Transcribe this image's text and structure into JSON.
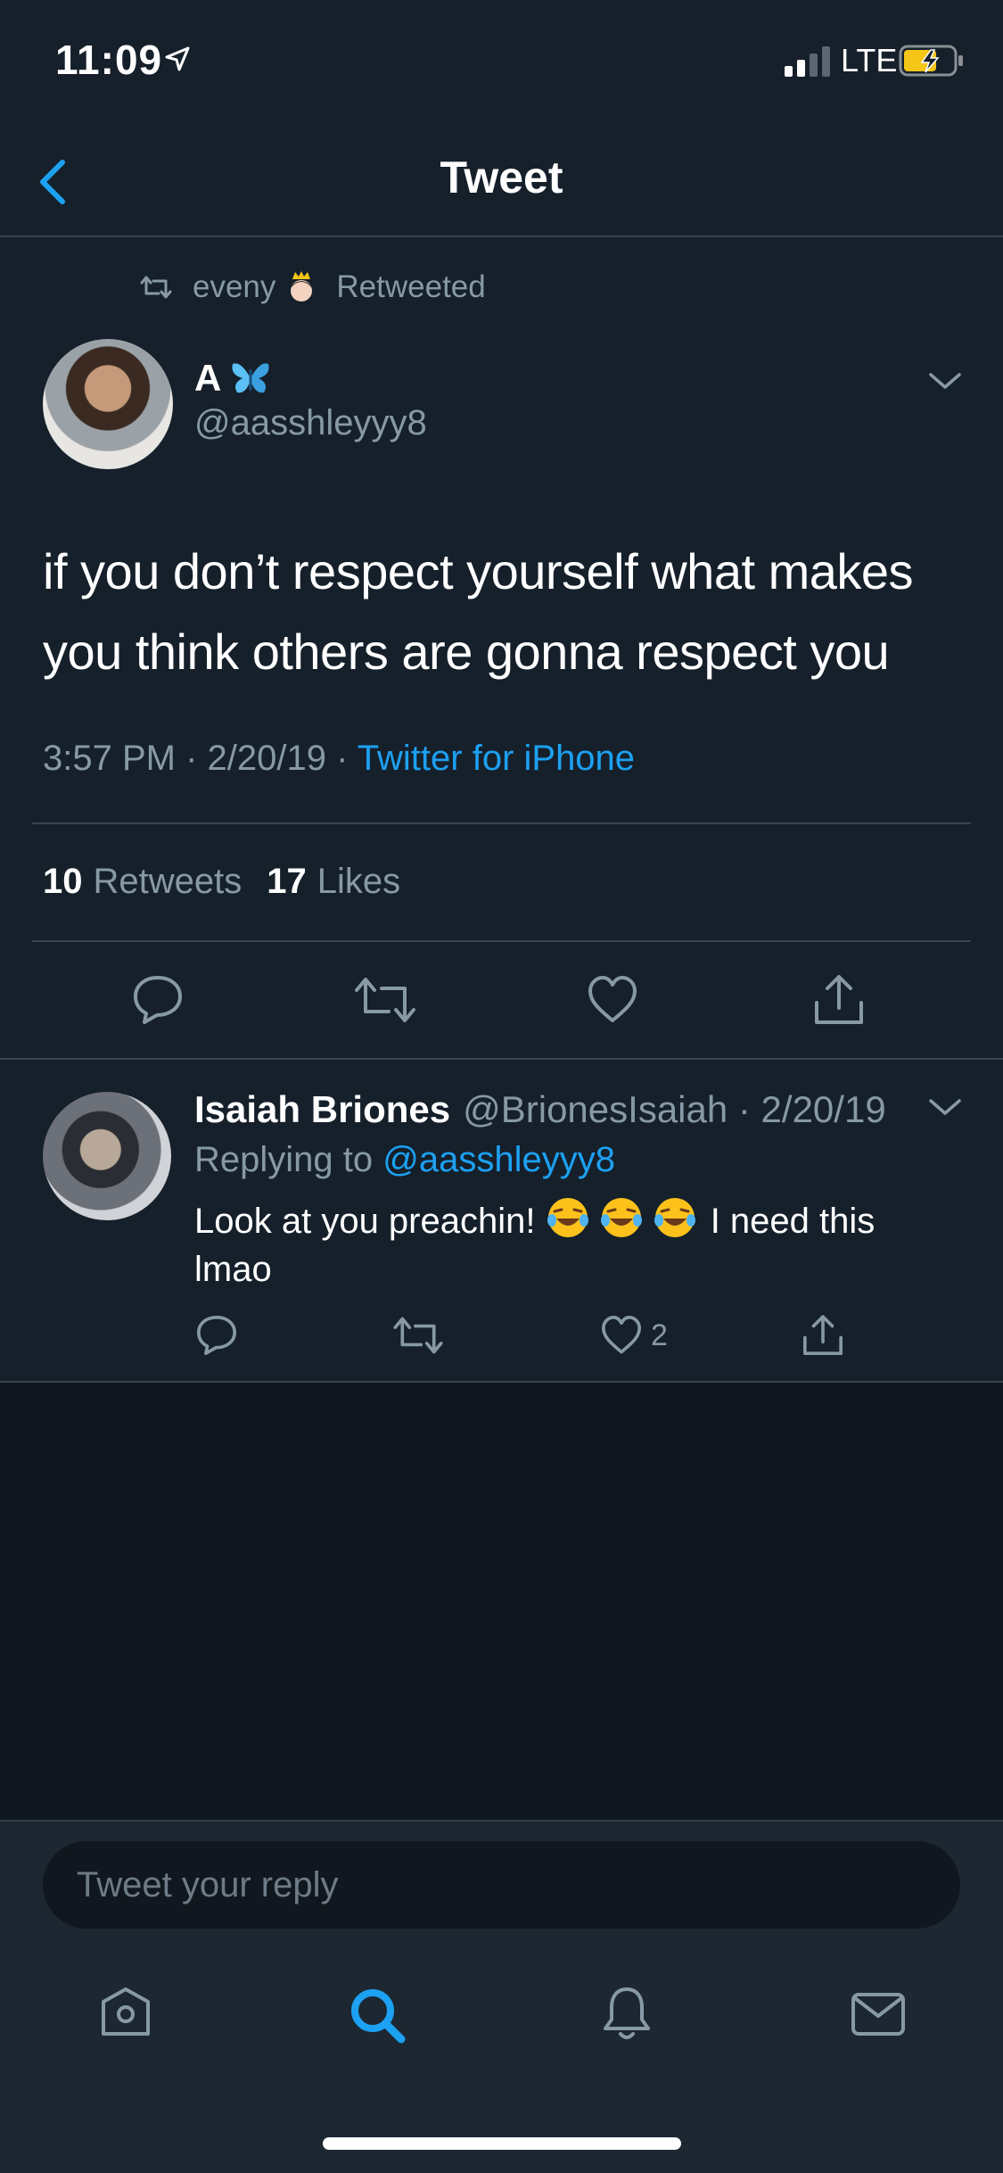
{
  "status_bar": {
    "time": "11:09",
    "network": "LTE"
  },
  "header": {
    "title": "Tweet"
  },
  "retweet_context": {
    "user": "eveny",
    "label": "Retweeted"
  },
  "tweet": {
    "author_name": "A",
    "author_handle": "@aasshleyyy8",
    "text": "if you don’t respect yourself what makes you think others are gonna respect you",
    "time_date": "3:57 PM · 2/20/19 · ",
    "source": "Twitter for iPhone",
    "retweet_count": "10",
    "retweet_label": "Retweets",
    "like_count": "17",
    "like_label": "Likes"
  },
  "reply": {
    "author_name": "Isaiah Briones",
    "author_meta": "@BrionesIsaiah · 2/20/19",
    "replying_label": "Replying to ",
    "replying_to": "@aasshleyyy8",
    "text_before": "Look at you preachin! ",
    "text_after": " I need this lmao",
    "like_count": "2"
  },
  "reply_box": {
    "placeholder": "Tweet your reply"
  },
  "colors": {
    "accent": "#1da1f2",
    "background": "#15202b",
    "secondary_text": "#8899a6"
  }
}
